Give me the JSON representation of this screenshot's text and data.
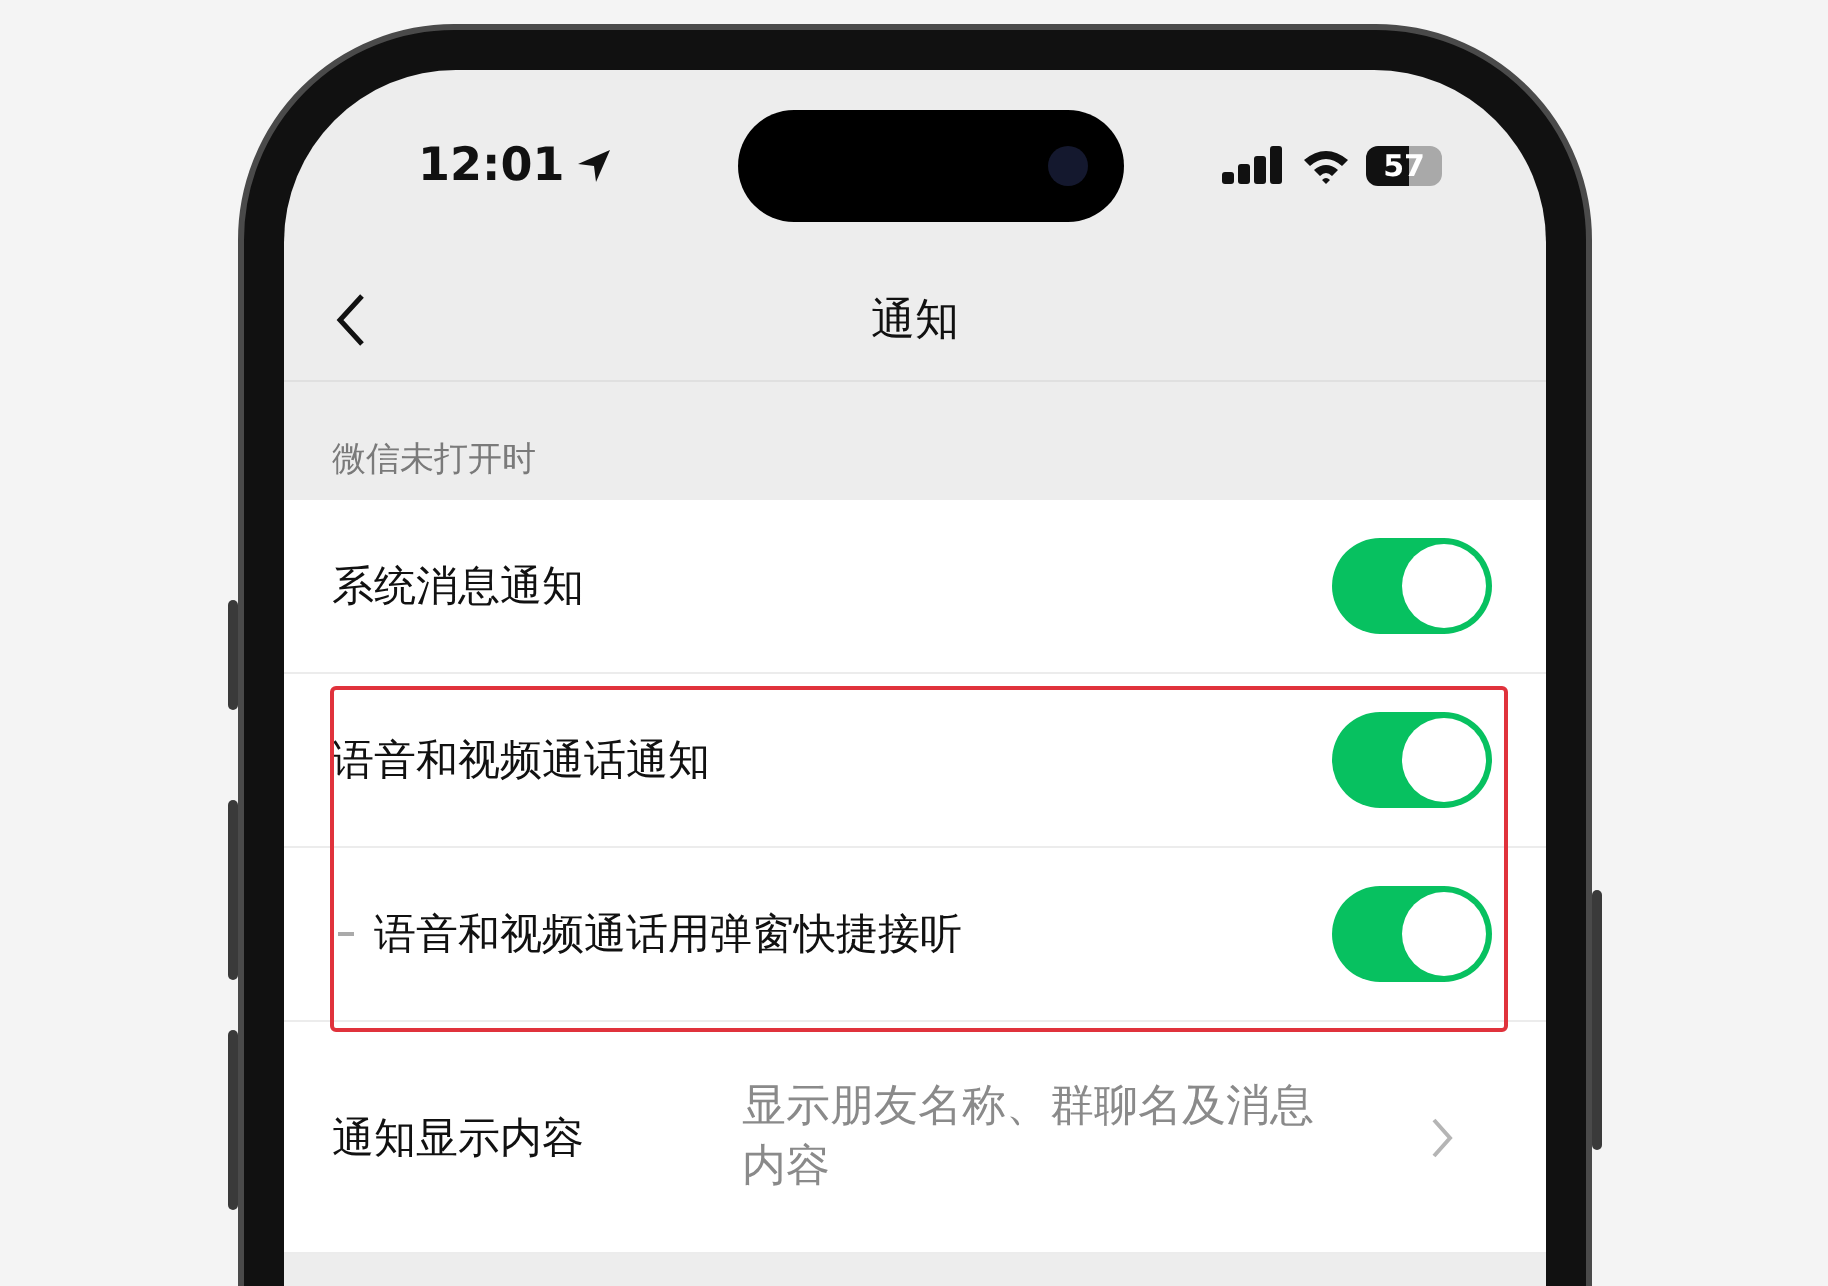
{
  "status_bar": {
    "time": "12:01",
    "battery": "57"
  },
  "nav": {
    "title": "通知"
  },
  "section": {
    "header": "微信未打开时"
  },
  "rows": [
    {
      "kind": "toggle",
      "label": "系统消息通知",
      "on": true,
      "highlighted": false,
      "indented": false
    },
    {
      "kind": "toggle",
      "label": "语音和视频通话通知",
      "on": true,
      "highlighted": true,
      "indented": false
    },
    {
      "kind": "toggle",
      "label": "语音和视频通话用弹窗快捷接听",
      "on": true,
      "highlighted": true,
      "indented": true
    },
    {
      "kind": "link",
      "label": "通知显示内容",
      "value": "显示朋友名称、群聊名及消息内容",
      "highlighted": false
    }
  ]
}
